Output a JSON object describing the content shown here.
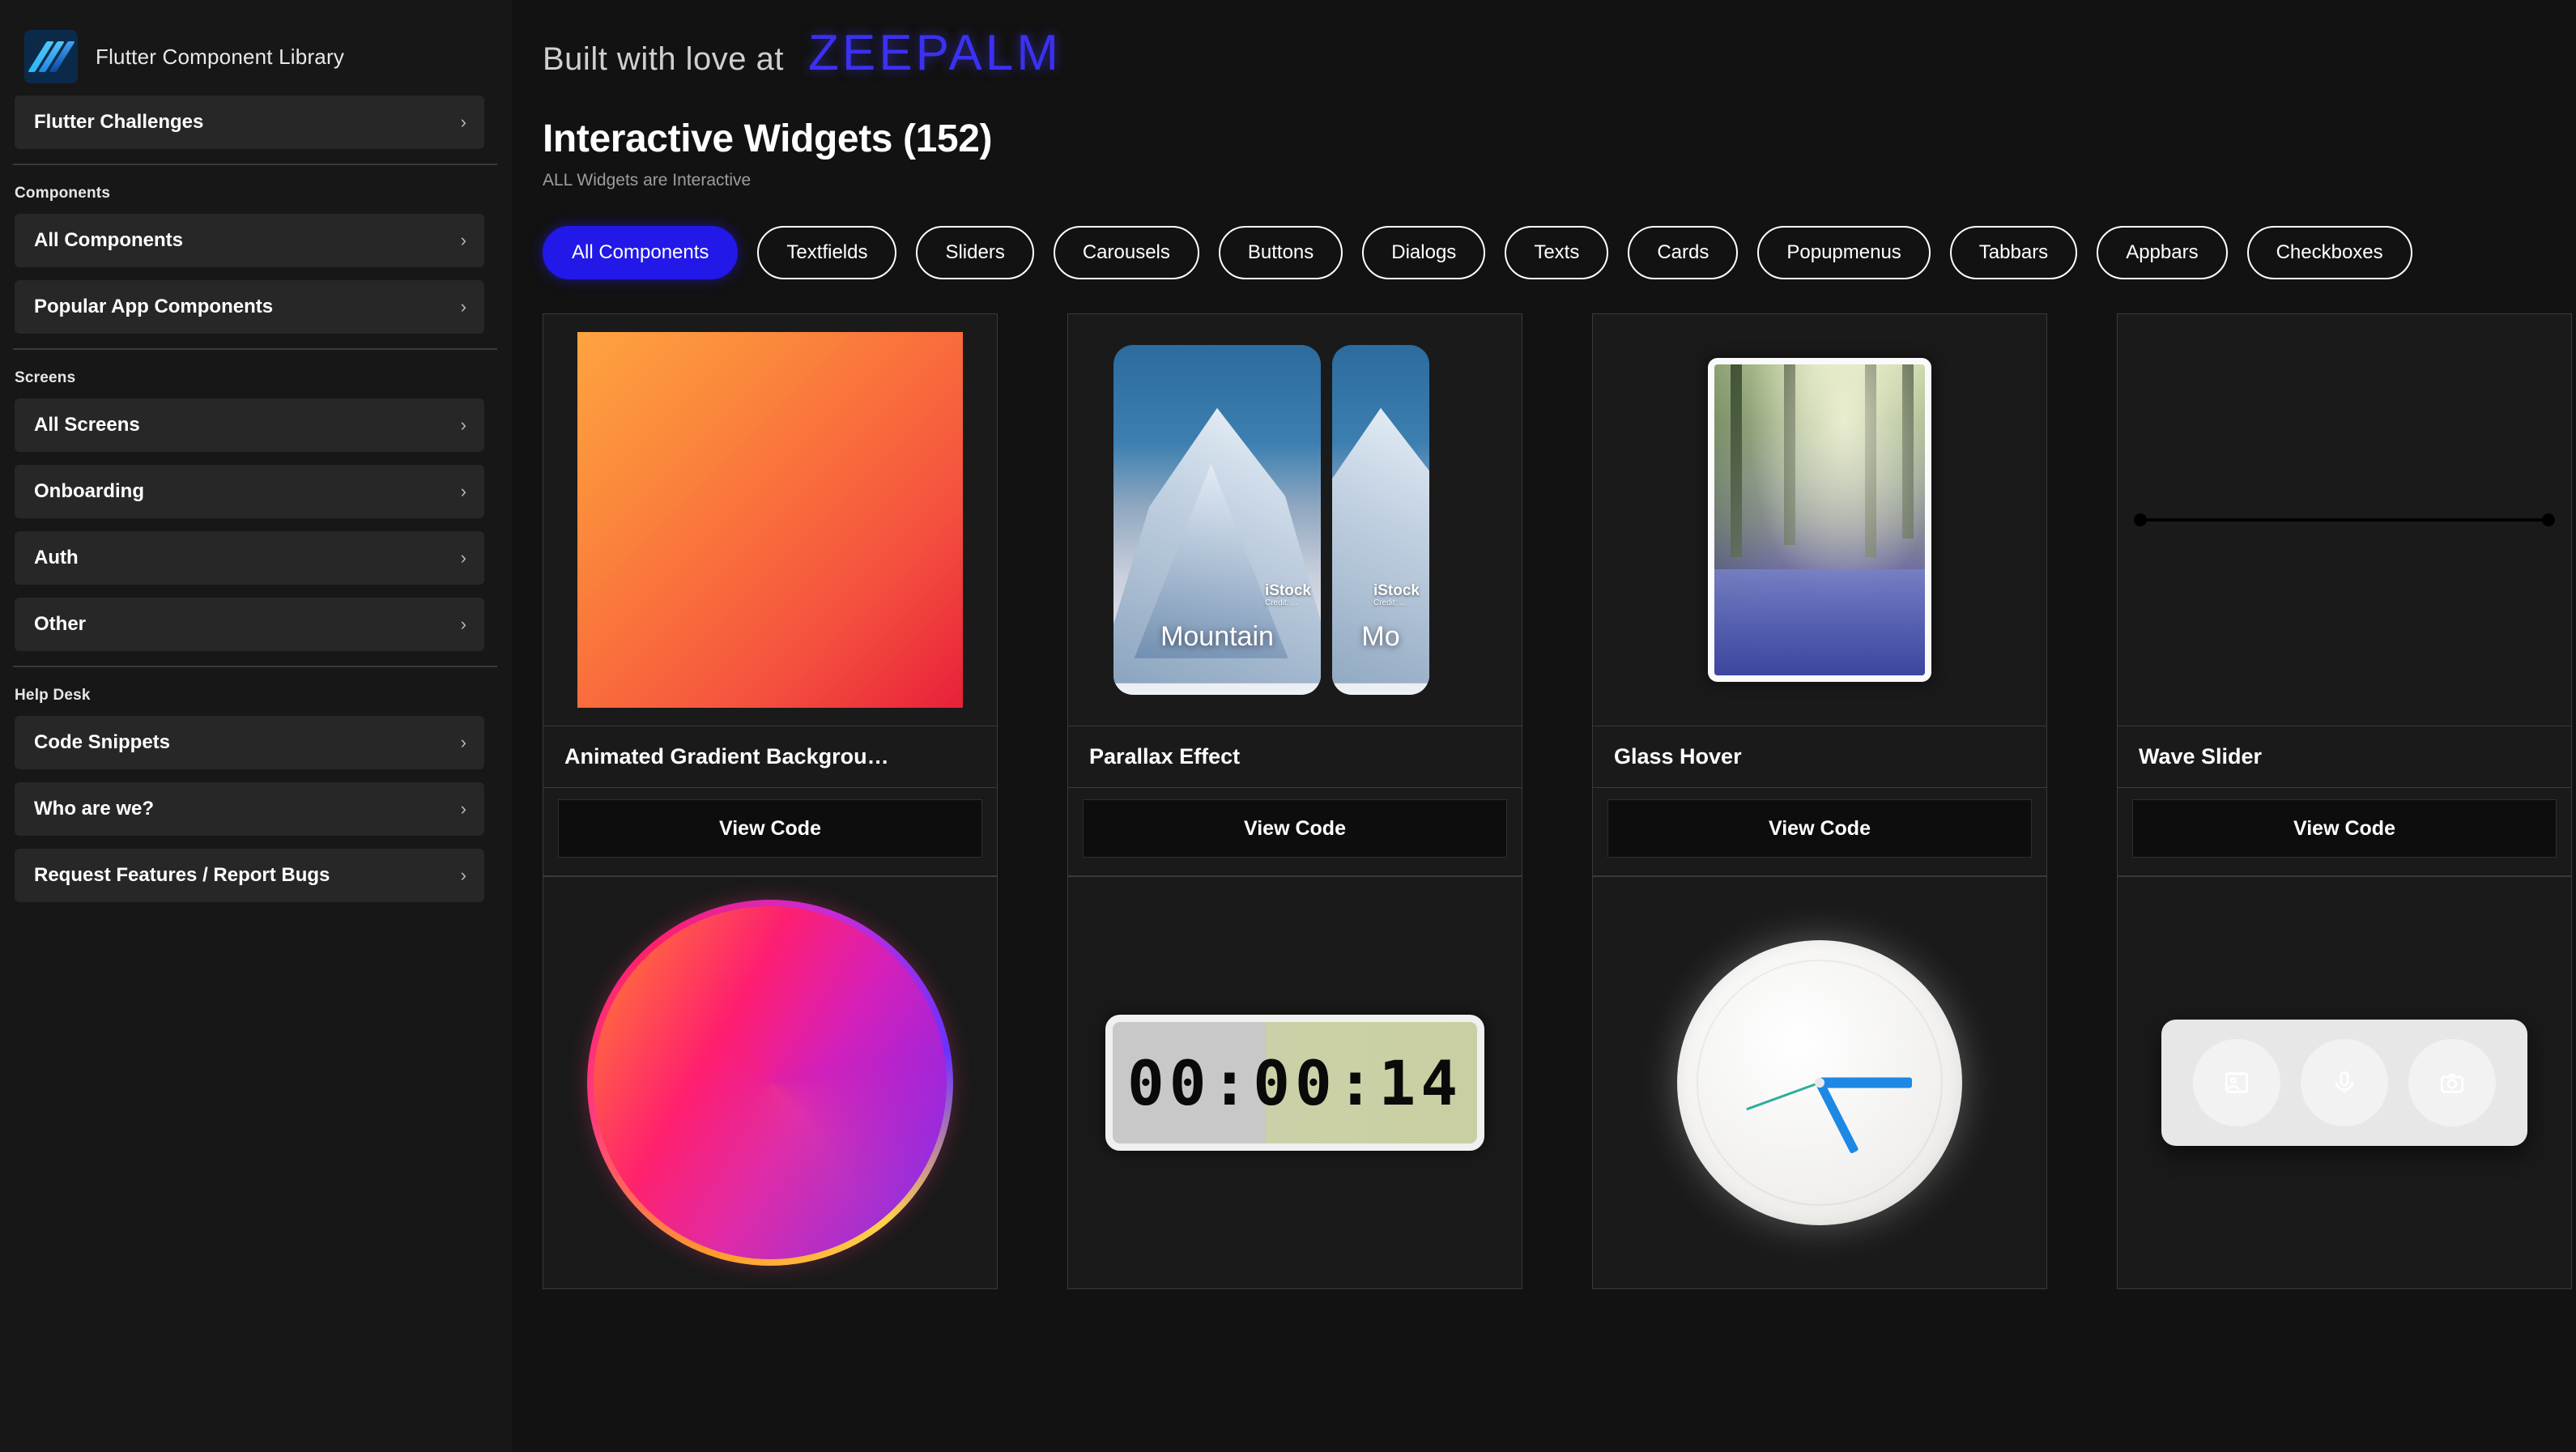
{
  "sidebar": {
    "brand": {
      "title": "Flutter Component Library",
      "logo_icon": "flutter-logo-icon"
    },
    "top_item": {
      "label": "Flutter Challenges",
      "chevron": "›"
    },
    "sections": [
      {
        "label": "Components",
        "items": [
          {
            "label": "All Components",
            "chevron": "›"
          },
          {
            "label": "Popular App Components",
            "chevron": "›"
          }
        ]
      },
      {
        "label": "Screens",
        "items": [
          {
            "label": "All Screens",
            "chevron": "›"
          },
          {
            "label": "Onboarding",
            "chevron": "›"
          },
          {
            "label": "Auth",
            "chevron": "›"
          },
          {
            "label": "Other",
            "chevron": "›"
          }
        ]
      },
      {
        "label": "Help Desk",
        "items": [
          {
            "label": "Code Snippets",
            "chevron": "›"
          },
          {
            "label": "Who are we?",
            "chevron": "›"
          },
          {
            "label": "Request Features / Report Bugs",
            "chevron": "›"
          }
        ]
      }
    ]
  },
  "banner": {
    "text": "Built with love at",
    "brand": "ZEEPALM",
    "brand_color": "#3b31f0"
  },
  "page": {
    "title": "Interactive Widgets (152)",
    "subtitle": "ALL Widgets are Interactive",
    "count": 152
  },
  "filters": {
    "selected": "All Components",
    "selected_color": "#2218e8",
    "chips": [
      "All Components",
      "Textfields",
      "Sliders",
      "Carousels",
      "Buttons",
      "Dialogs",
      "Texts",
      "Cards",
      "Popupmenus",
      "Tabbars",
      "Appbars",
      "Checkboxes"
    ]
  },
  "cards": [
    {
      "title": "Animated Gradient Backgrou…",
      "action": "View Code",
      "preview": "animated-gradient"
    },
    {
      "title": "Parallax Effect",
      "action": "View Code",
      "preview": "parallax",
      "image_label": "Mountain",
      "watermark": "iStock",
      "watermark_sub": "Credit: ..."
    },
    {
      "title": "Glass Hover",
      "action": "View Code",
      "preview": "glass-hover"
    },
    {
      "title": "Wave Slider",
      "action": "View Code",
      "preview": "wave-slider"
    },
    {
      "title": "",
      "action": "",
      "preview": "gradient-circle"
    },
    {
      "title": "",
      "action": "",
      "preview": "digital-clock",
      "clock_time": "00:00:14"
    },
    {
      "title": "",
      "action": "",
      "preview": "analog-clock"
    },
    {
      "title": "",
      "action": "",
      "preview": "navbar-widget"
    }
  ],
  "icons": {
    "chevron_right": "›"
  }
}
